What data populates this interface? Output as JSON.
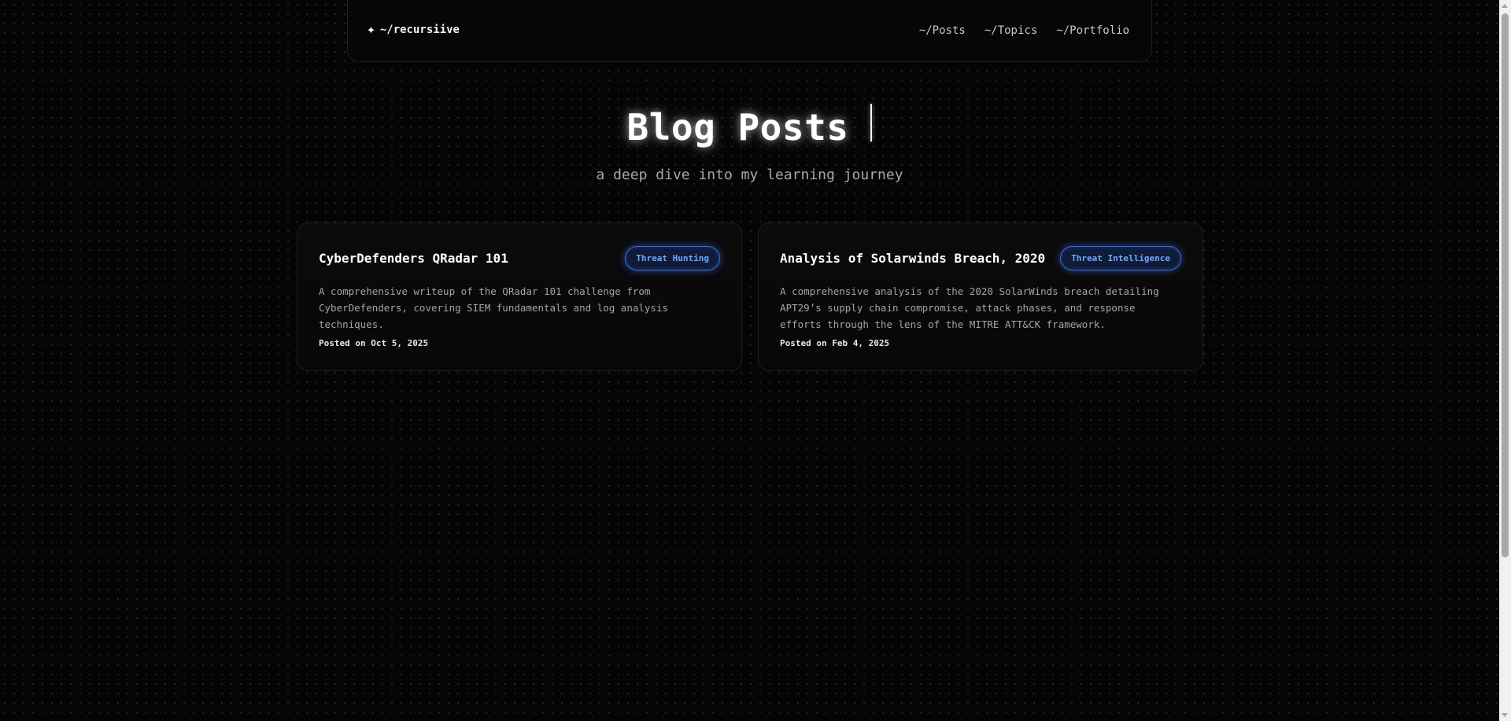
{
  "nav": {
    "brand_icon": "sparkle-icon",
    "brand": "~/recursiive",
    "links": [
      {
        "label": "~/Posts"
      },
      {
        "label": "~/Topics"
      },
      {
        "label": "~/Portfolio"
      }
    ]
  },
  "hero": {
    "title": "Blog Posts",
    "subtitle": "a deep dive into my learning journey"
  },
  "posts": [
    {
      "title": "CyberDefenders QRadar 101",
      "tag": "Threat Hunting",
      "description": "A comprehensive writeup of the QRadar 101 challenge from CyberDefenders, covering SIEM fundamentals and log analysis techniques.",
      "date": "Posted on Oct 5, 2025"
    },
    {
      "title": "Analysis of Solarwinds Breach, 2020",
      "tag": "Threat Intelligence",
      "description": "A comprehensive analysis of the 2020 SolarWinds breach detailing APT29’s supply chain compromise, attack phases, and response efforts through the lens of the MITRE ATT&CK framework.",
      "date": "Posted on Feb 4, 2025"
    }
  ],
  "colors": {
    "background": "#050505",
    "tag_accent": "#6ea8ff",
    "tag_border": "#3b6fd6"
  }
}
